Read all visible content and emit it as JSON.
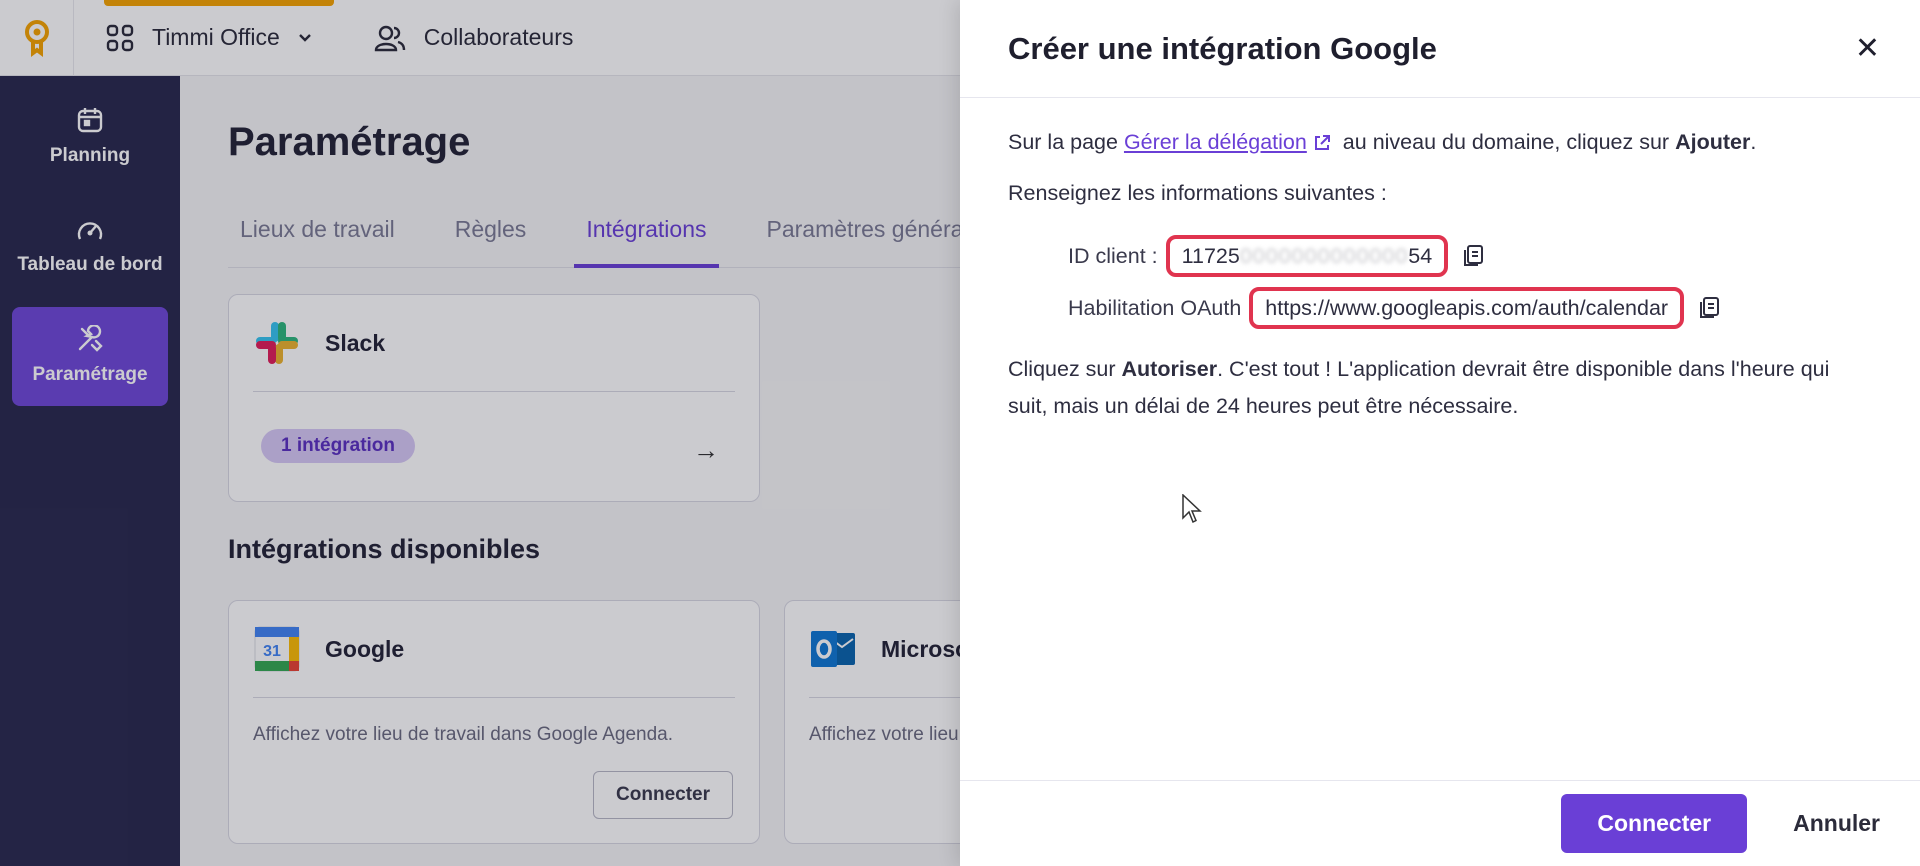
{
  "topbar": {
    "office_name": "Timmi Office",
    "collab_label": "Collaborateurs"
  },
  "sidebar": {
    "items": [
      {
        "label": "Planning",
        "icon": "calendar-icon",
        "active": false
      },
      {
        "label": "Tableau de bord",
        "icon": "gauge-icon",
        "active": false
      },
      {
        "label": "Paramétrage",
        "icon": "tools-icon",
        "active": true
      }
    ]
  },
  "main": {
    "title": "Paramétrage",
    "tabs": [
      {
        "label": "Lieux de travail",
        "active": false
      },
      {
        "label": "Règles",
        "active": false
      },
      {
        "label": "Intégrations",
        "active": true
      },
      {
        "label": "Paramètres générau",
        "active": false
      }
    ],
    "slack_card": {
      "name": "Slack",
      "chip": "1 intégration"
    },
    "available_title": "Intégrations disponibles",
    "google_card": {
      "name": "Google",
      "desc": "Affichez votre lieu de travail dans Google Agenda.",
      "button": "Connecter"
    },
    "microsoft_card": {
      "name": "Microso",
      "desc": "Affichez votre lieu"
    }
  },
  "modal": {
    "title": "Créer une intégration Google",
    "intro_prefix": "Sur la page ",
    "intro_link": "Gérer la délégation",
    "intro_suffix": " au niveau du domaine, cliquez sur ",
    "intro_bold": "Ajouter",
    "intro_end": ".",
    "info_line": "Renseignez les informations suivantes :",
    "client_id_label": "ID client :",
    "client_id_start": "11725",
    "client_id_masked": "0000000000000",
    "client_id_end": "54",
    "oauth_label": "Habilitation OAuth",
    "oauth_value": "https://www.googleapis.com/auth/calendar",
    "closing_prefix": "Cliquez sur ",
    "closing_bold": "Autoriser",
    "closing_rest": ". C'est tout ! L'application devrait être disponible dans l'heure qui suit, mais un délai de 24 heures peut être nécessaire.",
    "primary_button": "Connecter",
    "cancel_button": "Annuler"
  },
  "colors": {
    "accent": "#6a3fd6",
    "sidebar_bg": "#28284e",
    "highlight": "#e0344f",
    "brand_orange": "#f5a300"
  }
}
